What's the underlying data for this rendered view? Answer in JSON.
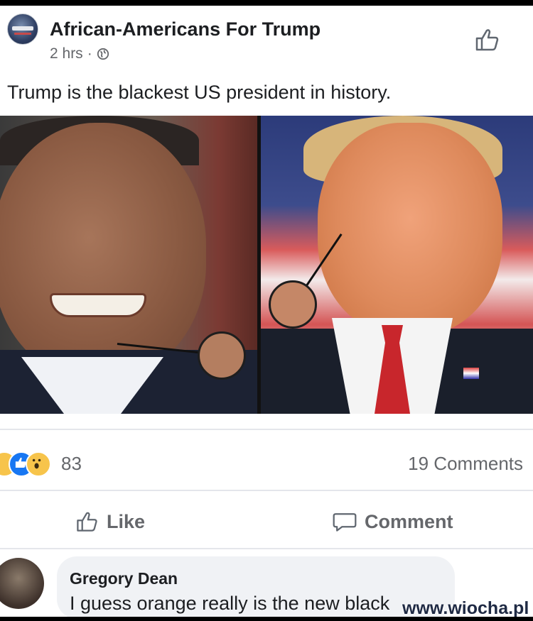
{
  "post": {
    "page_name": "African-Americans For Trump",
    "time": "2 hrs",
    "meta_separator": "·",
    "audience_icon": "globe-icon",
    "text": "Trump is the blackest US president in history."
  },
  "stats": {
    "reaction_icons": [
      "haha-icon",
      "like-icon",
      "wow-icon"
    ],
    "reaction_count": "83",
    "comment_count": "19 Comments"
  },
  "actions": {
    "like_label": "Like",
    "comment_label": "Comment"
  },
  "comment": {
    "author": "Gregory Dean",
    "text": "I guess orange really is the new black"
  },
  "watermark": "www.wiocha.pl",
  "colors": {
    "like_blue": "#1877f2",
    "secondary_text": "#65676b",
    "bubble_bg": "#f0f2f5"
  }
}
